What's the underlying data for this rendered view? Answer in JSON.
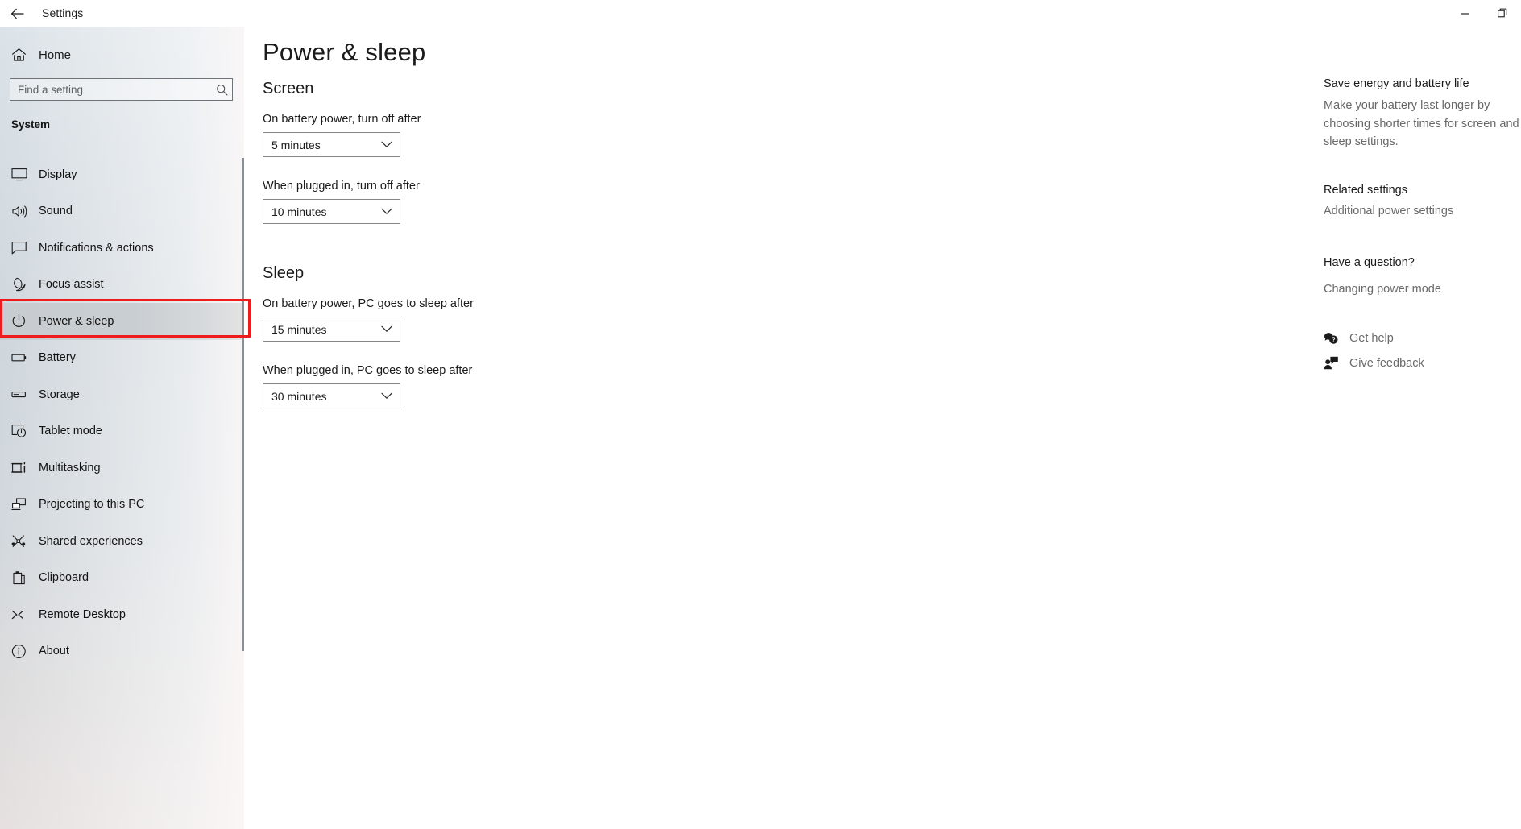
{
  "window": {
    "app_title": "Settings",
    "back_icon": "back-arrow-icon",
    "controls": [
      {
        "name": "minimize",
        "glyph": "─"
      },
      {
        "name": "restore",
        "glyph": "❐"
      }
    ]
  },
  "sidebar": {
    "home_label": "Home",
    "home_icon": "home-icon",
    "search": {
      "placeholder": "Find a setting",
      "value": "",
      "icon": "search-icon"
    },
    "group_title": "System",
    "items": [
      {
        "label": "Display",
        "icon": "monitor-icon",
        "selected": false
      },
      {
        "label": "Sound",
        "icon": "speaker-icon",
        "selected": false
      },
      {
        "label": "Notifications & actions",
        "icon": "notification-icon",
        "selected": false
      },
      {
        "label": "Focus assist",
        "icon": "moon-icon",
        "selected": false
      },
      {
        "label": "Power & sleep",
        "icon": "power-icon",
        "selected": true
      },
      {
        "label": "Battery",
        "icon": "battery-icon",
        "selected": false
      },
      {
        "label": "Storage",
        "icon": "storage-icon",
        "selected": false
      },
      {
        "label": "Tablet mode",
        "icon": "tablet-icon",
        "selected": false
      },
      {
        "label": "Multitasking",
        "icon": "multitasking-icon",
        "selected": false
      },
      {
        "label": "Projecting to this PC",
        "icon": "projecting-icon",
        "selected": false
      },
      {
        "label": "Shared experiences",
        "icon": "share-icon",
        "selected": false
      },
      {
        "label": "Clipboard",
        "icon": "clipboard-icon",
        "selected": false
      },
      {
        "label": "Remote Desktop",
        "icon": "remote-desktop-icon",
        "selected": false
      },
      {
        "label": "About",
        "icon": "info-icon",
        "selected": false
      }
    ],
    "highlight_color": "#ee1c1c"
  },
  "main": {
    "page_title": "Power & sleep",
    "sections": [
      {
        "heading": "Screen"
      },
      {
        "heading": "Sleep"
      }
    ],
    "fields": [
      {
        "label": "On battery power, turn off after",
        "value": "5 minutes"
      },
      {
        "label": "When plugged in, turn off after",
        "value": "10 minutes"
      },
      {
        "label": "On battery power, PC goes to sleep after",
        "value": "15 minutes"
      },
      {
        "label": "When plugged in, PC goes to sleep after",
        "value": "30 minutes"
      }
    ]
  },
  "right_panel": {
    "save_energy_heading": "Save energy and battery life",
    "save_energy_body": "Make your battery last longer by choosing shorter times for screen and sleep settings.",
    "related_heading": "Related settings",
    "related_link": "Additional power settings",
    "question_heading": "Have a question?",
    "question_link": "Changing power mode",
    "get_help": "Get help",
    "get_help_icon": "help-chat-icon",
    "give_feedback": "Give feedback",
    "give_feedback_icon": "feedback-person-icon"
  }
}
